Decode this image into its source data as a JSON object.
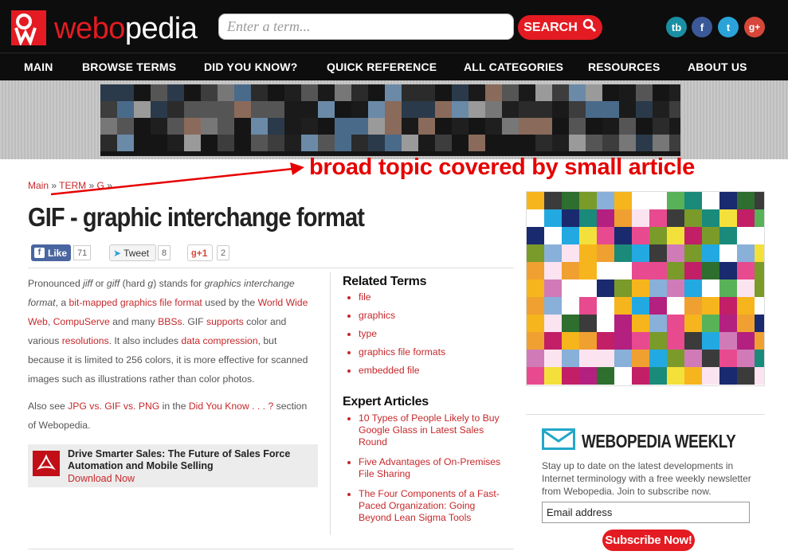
{
  "header": {
    "logo_red": "webo",
    "logo_white": "pedia",
    "search_placeholder": "Enter a term...",
    "search_button": "SEARCH",
    "social": [
      "tb",
      "f",
      "t",
      "g+"
    ]
  },
  "nav": {
    "items": [
      "MAIN",
      "BROWSE TERMS",
      "DID YOU KNOW?",
      "QUICK REFERENCE",
      "ALL CATEGORIES",
      "RESOURCES",
      "ABOUT US"
    ]
  },
  "breadcrumb": {
    "main": "Main",
    "term": "TERM",
    "letter": "G",
    "sep": "»"
  },
  "annotation": "broad topic covered by small article",
  "title": "GIF - graphic interchange format",
  "share": {
    "like_label": "Like",
    "like_count": "71",
    "tweet_label": "Tweet",
    "tweet_count": "8",
    "gplus_label": "+1",
    "gplus_count": "2"
  },
  "article": {
    "p1_a": "Pronounced ",
    "p1_jiff": "jiff",
    "p1_b": " or ",
    "p1_giff": "giff",
    "p1_c": " (hard ",
    "p1_g": "g",
    "p1_d": ") stands for ",
    "p1_gif": "graphics interchange format",
    "p1_e": ", a ",
    "link_bitmapped": "bit-mapped graphics file format",
    "p1_f": " used by the ",
    "link_www": "World Wide Web",
    "p1_g2": ", ",
    "link_compuserve": "CompuServe",
    "p1_h": " and many ",
    "link_bbs": "BBSs",
    "p1_i": ". GIF ",
    "link_supports": "supports",
    "p1_j": " color and various ",
    "link_resolutions": "resolutions",
    "p1_k": ". It also includes ",
    "link_compression": "data compression",
    "p1_l": ", but because it is limited to 256 colors, it is more effective for scanned images such as illustrations rather than color photos.",
    "p2_a": "Also see ",
    "link_jpg": "JPG vs. GIF vs. PNG",
    "p2_b": " in the ",
    "link_dyk": "Did You Know . . . ?",
    "p2_c": " section of Webopedia."
  },
  "promo": {
    "title": "Drive Smarter Sales: The Future of Sales Force Automation and Mobile Selling",
    "link": "Download Now"
  },
  "related": {
    "heading": "Related Terms",
    "items": [
      "file",
      "graphics",
      "type",
      "graphics file formats",
      "embedded file"
    ]
  },
  "expert": {
    "heading": "Expert Articles",
    "items": [
      "10 Types of People Likely to Buy Google Glass in Latest Sales Round",
      "Five Advantages of On-Premises File Sharing",
      "The Four Components of a Fast-Paced Organization: Going Beyond Lean Sigma Tools"
    ]
  },
  "weekly": {
    "title": "WEBOPEDIA WEEKLY",
    "desc": "Stay up to date on the latest developments in Internet terminology with a free weekly newsletter from Webopedia. Join to subscribe now.",
    "email_placeholder": "Email address",
    "subscribe": "Subscribe Now!"
  },
  "colors": {
    "brand_red": "#e41b22",
    "link_red": "#c6282b",
    "header_black": "#0d0d0d"
  }
}
